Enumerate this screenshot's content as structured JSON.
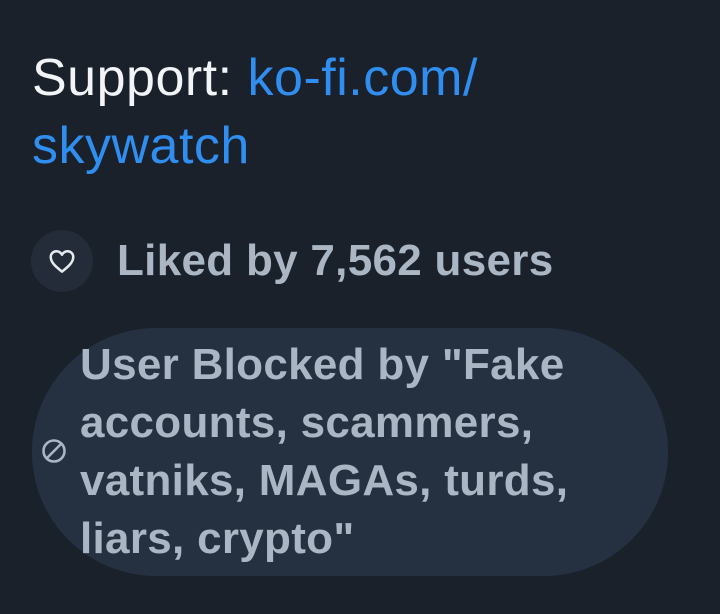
{
  "support": {
    "label": "Support: ",
    "link_line1": "ko-fi.com/",
    "link_line2": "skywatch"
  },
  "likes": {
    "text": "Liked by 7,562 users",
    "icon": "heart-icon"
  },
  "block_notice": {
    "icon": "block-icon",
    "text": "User Blocked by \"Fake accounts, scammers, vatniks, MAGAs, turds, liars, crypto\""
  },
  "colors": {
    "background": "#1a212b",
    "link": "#2f8ef0",
    "primary_text": "#f2f4f7",
    "muted_text": "#aab6c4",
    "pill": "#253140"
  }
}
